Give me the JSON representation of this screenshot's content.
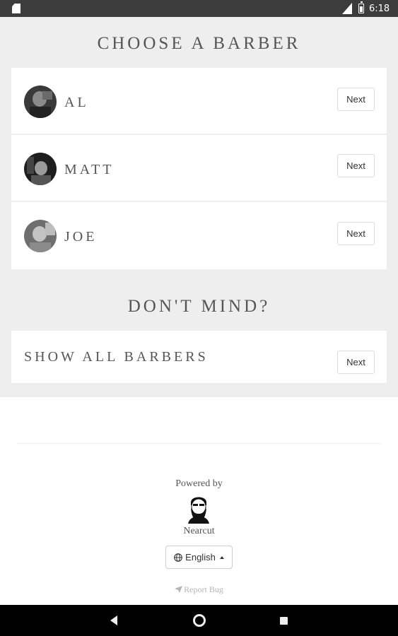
{
  "status_bar": {
    "time": "6:18",
    "icons": [
      "sd-card-icon",
      "signal-icon",
      "battery-icon"
    ]
  },
  "header": {
    "title": "CHOOSE A BARBER"
  },
  "barbers": [
    {
      "name": "AL",
      "next_label": "Next"
    },
    {
      "name": "MATT",
      "next_label": "Next"
    },
    {
      "name": "JOE",
      "next_label": "Next"
    }
  ],
  "dont_mind": {
    "title": "DON'T MIND?",
    "show_all_label": "SHOW ALL BARBERS",
    "next_label": "Next"
  },
  "footer": {
    "powered_by": "Powered by",
    "brand": "Nearcut",
    "language": "English",
    "report_bug": "Report Bug"
  },
  "nav_bar": {
    "icons": [
      "back-icon",
      "home-icon",
      "recents-icon"
    ]
  },
  "colors": {
    "background": "#eeeeee",
    "card": "#ffffff",
    "text": "#555555",
    "status_bar": "#3c3c3c"
  }
}
